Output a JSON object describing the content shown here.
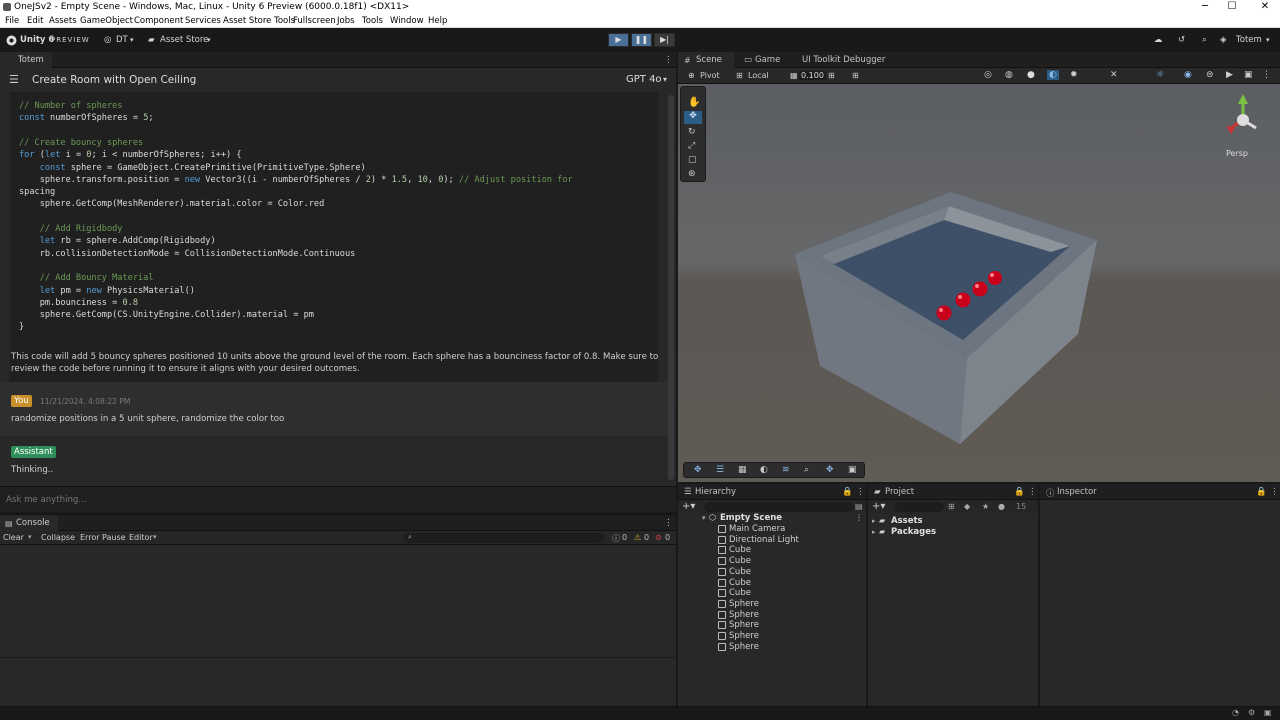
{
  "window": {
    "title": "OneJSv2 - Empty Scene - Windows, Mac, Linux - Unity 6 Preview (6000.0.18f1) <DX11>",
    "minimize": "─",
    "maximize": "☐",
    "close": "✕"
  },
  "menu": [
    "File",
    "Edit",
    "Assets",
    "GameObject",
    "Component",
    "Services",
    "Asset Store Tools",
    "Fullscreen",
    "Jobs",
    "Tools",
    "Window",
    "Help"
  ],
  "toolbar": {
    "brand": "Unity 6",
    "brand_suffix": "PREVIEW",
    "account": "DT",
    "asset_store": "Asset Store",
    "layout": "Totem"
  },
  "totem": {
    "tab": "Totem",
    "header_title": "Create Room with Open Ceiling",
    "model": "GPT 4o",
    "code_lines": [
      [
        "cmt",
        "// Number of spheres"
      ],
      [
        "mix",
        "const numberOfSpheres = 5;"
      ],
      [
        "blank",
        ""
      ],
      [
        "cmt",
        "// Create bouncy spheres"
      ],
      [
        "mix",
        "for (let i = 0; i < numberOfSpheres; i++) {"
      ],
      [
        "mix",
        "    const sphere = GameObject.CreatePrimitive(PrimitiveType.Sphere)"
      ],
      [
        "mix",
        "    sphere.transform.position = new Vector3((i - numberOfSpheres / 2) * 1.5, 10, 0); // Adjust position for"
      ],
      [
        "mix",
        "spacing"
      ],
      [
        "mix",
        "    sphere.GetComp(MeshRenderer).material.color = Color.red"
      ],
      [
        "blank",
        ""
      ],
      [
        "cmt",
        "    // Add Rigidbody"
      ],
      [
        "mix",
        "    let rb = sphere.AddComp(Rigidbody)"
      ],
      [
        "mix",
        "    rb.collisionDetectionMode = CollisionDetectionMode.Continuous"
      ],
      [
        "blank",
        ""
      ],
      [
        "cmt",
        "    // Add Bouncy Material"
      ],
      [
        "mix",
        "    let pm = new PhysicsMaterial()"
      ],
      [
        "mix",
        "    pm.bounciness = 0.8"
      ],
      [
        "mix",
        "    sphere.GetComp(CS.UnityEngine.Collider).material = pm"
      ],
      [
        "mix",
        "}"
      ]
    ],
    "summary": "This code will add 5 bouncy spheres positioned 10 units above the ground level of the room. Each sphere has a bounciness factor of 0.8. Make sure to review the code before running it to ensure it aligns with your desired outcomes.",
    "user_badge": "You",
    "user_time": "11/21/2024, 4:08:22 PM",
    "user_msg": "randomize positions in a 5 unit sphere, randomize the color too",
    "assistant_badge": "Assistant",
    "assistant_msg": "Thinking..",
    "input_placeholder": "Ask me anything..."
  },
  "console": {
    "tab": "Console",
    "clear": "Clear",
    "collapse": "Collapse",
    "error_pause": "Error Pause",
    "editor": "Editor",
    "count_log": "0",
    "count_warn": "0",
    "count_err": "0"
  },
  "scene": {
    "tabs": [
      "Scene",
      "Game",
      "UI Toolkit Debugger"
    ],
    "pivot": "Pivot",
    "local": "Local",
    "snap": "0.100",
    "persp": "Persp"
  },
  "hierarchy": {
    "tab": "Hierarchy",
    "scene": "Empty Scene",
    "items": [
      "Main Camera",
      "Directional Light",
      "Cube",
      "Cube",
      "Cube",
      "Cube",
      "Cube",
      "Sphere",
      "Sphere",
      "Sphere",
      "Sphere",
      "Sphere"
    ]
  },
  "project": {
    "tab": "Project",
    "folders": [
      "Assets",
      "Packages"
    ],
    "count": "15"
  },
  "inspector": {
    "tab": "Inspector"
  },
  "colors": {
    "accent": "#2c5d87",
    "you_badge": "#c9902a",
    "assistant_badge": "#2f8f5b",
    "sphere": "#d3001a"
  }
}
